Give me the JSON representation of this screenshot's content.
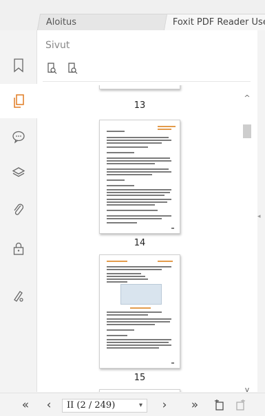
{
  "tabs": [
    {
      "label": "Aloitus"
    },
    {
      "label": "Foxit PDF Reader Use"
    }
  ],
  "panel": {
    "title": "Sivut",
    "tools": [
      "page-options-icon",
      "page-properties-icon"
    ]
  },
  "sidebar": {
    "items": [
      {
        "name": "bookmarks-icon",
        "active": false
      },
      {
        "name": "pages-icon",
        "active": true
      },
      {
        "name": "comments-icon",
        "active": false
      },
      {
        "name": "layers-icon",
        "active": false
      },
      {
        "name": "attachments-icon",
        "active": false
      },
      {
        "name": "security-icon",
        "active": false
      },
      {
        "name": "signatures-icon",
        "active": false
      }
    ]
  },
  "thumbnails": [
    {
      "page": "13"
    },
    {
      "page": "14"
    },
    {
      "page": "15"
    }
  ],
  "navigation": {
    "page_value": "II (2 / 249)",
    "first": "«",
    "prev": "‹",
    "next": "›",
    "last": "»"
  },
  "colors": {
    "accent": "#e07b22",
    "active_bg": "#ffffff",
    "panel_bg": "#ffffff"
  }
}
